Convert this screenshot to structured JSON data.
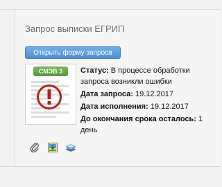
{
  "card": {
    "title": "Запрос выписки ЕГРИП",
    "open_form_label": "Открыть форму запроса",
    "document": {
      "badge": "СМЭВ 3",
      "state_icon": "error-exclamation-icon"
    },
    "status_label": "Статус:",
    "status_value": " В процессе обработки запроса возникли ошибки",
    "request_date_label": "Дата запроса:",
    "request_date_value": " 19.12.2017",
    "exec_date_label": "Дата исполнения:",
    "exec_date_value": " 19.12.2017",
    "deadline_label": "До окончания срока осталось:",
    "deadline_value": " 1 день",
    "actions": [
      {
        "icon": "paperclip-icon"
      },
      {
        "icon": "download-icon"
      },
      {
        "icon": "stack-icon"
      }
    ]
  },
  "colors": {
    "button": "#4d8fd6",
    "badge": "#5aa040",
    "error": "#b3221e"
  }
}
